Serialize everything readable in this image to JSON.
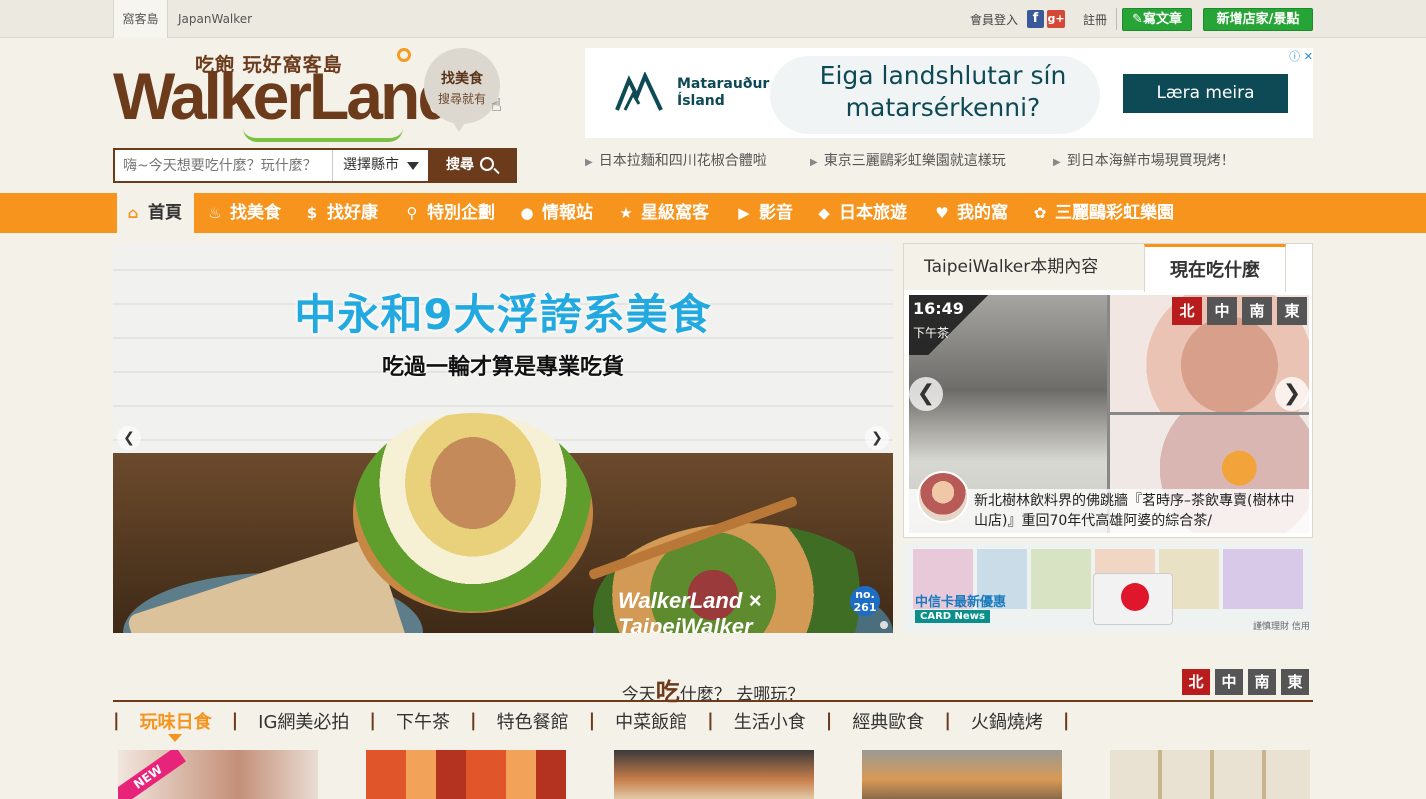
{
  "topbar": {
    "tab_main": "窩客島",
    "tab_japan": "JapanWalker",
    "login": "會員登入",
    "facebook": "f",
    "google": "g+",
    "register": "註冊",
    "write_article": "寫文章",
    "add_store": "新增店家/景點"
  },
  "logo": {
    "tagline": "吃飽 玩好窩客島",
    "wordmark": "WalkerLand"
  },
  "bubble": {
    "line1": "找美食",
    "line2": "搜尋就有"
  },
  "search": {
    "placeholder": "嗨~今天想要吃什麼？玩什麼？",
    "city_select": "選擇縣市",
    "button": "搜尋"
  },
  "ad": {
    "brand_line1": "Matarauður",
    "brand_line2": "Ísland",
    "headline": "Eiga landshlutar sín matarsérkenni?",
    "cta": "Læra meira",
    "adchoices": "ⓘ ✕"
  },
  "quick_links": [
    "日本拉麵和四川花椒合體啦",
    "東京三麗鷗彩虹樂園就這樣玩",
    "到日本海鮮市場現買現烤！"
  ],
  "nav": {
    "items": [
      {
        "label": "首頁",
        "icon": "home-icon"
      },
      {
        "label": "找美食",
        "icon": "food-icon"
      },
      {
        "label": "找好康",
        "icon": "coin-icon"
      },
      {
        "label": "特別企劃",
        "icon": "pin-icon"
      },
      {
        "label": "情報站",
        "icon": "chat-icon"
      },
      {
        "label": "星級窩客",
        "icon": "star-icon"
      },
      {
        "label": "影音",
        "icon": "video-icon"
      },
      {
        "label": "日本旅遊",
        "icon": "diamond-icon"
      },
      {
        "label": "我的窩",
        "icon": "heart-icon"
      },
      {
        "label": "三麗鷗彩虹樂園",
        "icon": "sanrio-icon"
      }
    ]
  },
  "banner": {
    "title": "中永和9大浮誇系美食",
    "subtitle": "吃過一輪才算是專業吃貨",
    "brand": "WalkerLand × TaipeiWalker",
    "issue_line1": "no.",
    "issue_line2": "261"
  },
  "right_panel": {
    "tab_taipei": "TaipeiWalker本期內容",
    "tab_now": "現在吃什麼",
    "time": "16:49",
    "time_label": "下午茶",
    "regions": [
      "北",
      "中",
      "南",
      "東"
    ],
    "caption": "新北樹林飲料界的佛跳牆『茗時序–茶飲專賣(樹林中山店)』重回70年代高雄阿婆的綜合茶/"
  },
  "promo_strip": {
    "title": "中信卡最新優惠",
    "badge": "CARD News",
    "note": "謹慎理財 信用至上"
  },
  "section": {
    "title_pre": "今天",
    "title_big": "吃",
    "title_post": "什麼？ 去哪玩？",
    "regions": [
      "北",
      "中",
      "南",
      "東"
    ],
    "categories": [
      "玩味日食",
      "IG網美必拍",
      "下午茶",
      "特色餐館",
      "中菜飯館",
      "生活小食",
      "經典歐食",
      "火鍋燒烤"
    ],
    "new_tag": "NEW"
  }
}
